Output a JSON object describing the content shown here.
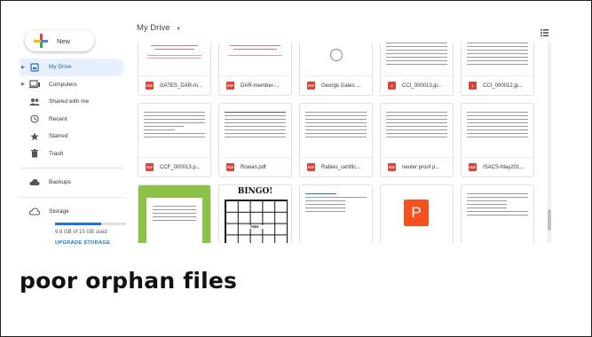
{
  "app": {
    "new_label": "New",
    "title": "My Drive"
  },
  "nav": [
    {
      "label": "My Drive",
      "icon": "drive-icon",
      "active": true
    },
    {
      "label": "Computers",
      "icon": "computer-icon",
      "active": false
    },
    {
      "label": "Shared with me",
      "icon": "people-icon",
      "active": false
    },
    {
      "label": "Recent",
      "icon": "clock-icon",
      "active": false
    },
    {
      "label": "Starred",
      "icon": "star-icon",
      "active": false
    },
    {
      "label": "Trash",
      "icon": "trash-icon",
      "active": false
    }
  ],
  "backups_label": "Backups",
  "storage": {
    "label": "Storage",
    "used_text": "9.8 GB of 15 GB used",
    "upgrade_label": "UPGRADE STORAGE",
    "used_fraction": 0.65
  },
  "files": [
    {
      "name": "GATES_DAR-m...",
      "type": "pdf"
    },
    {
      "name": "DAR-member-...",
      "type": "pdf"
    },
    {
      "name": "George Gates ...",
      "type": "pdf"
    },
    {
      "name": "CCI_000013.jp...",
      "type": "image"
    },
    {
      "name": "CCI_000012.jp...",
      "type": "image"
    },
    {
      "name": "CCF_000013.p...",
      "type": "pdf"
    },
    {
      "name": "Rowan.pdf",
      "type": "pdf"
    },
    {
      "name": "Rabies_certific...",
      "type": "pdf"
    },
    {
      "name": "neuter proof p...",
      "type": "pdf"
    },
    {
      "name": "ISACS-May201...",
      "type": "pdf"
    }
  ],
  "thumb_text": {
    "bingo": "BINGO!",
    "free": "FREE",
    "slides_letter": "P"
  },
  "caption": "poor orphan files",
  "colors": {
    "accent_blue": "#1a73e8",
    "active_bg": "#e8f0fe",
    "pdf_red": "#db4437",
    "slides_orange": "#f4511e"
  }
}
